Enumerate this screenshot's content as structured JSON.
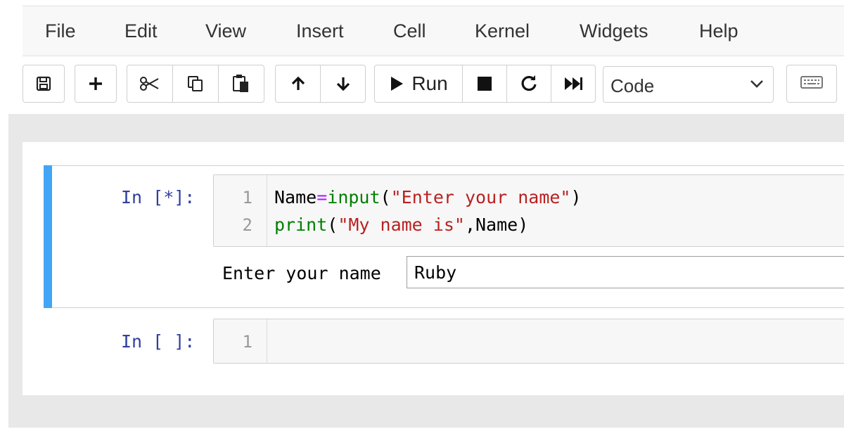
{
  "menubar": {
    "items": [
      "File",
      "Edit",
      "View",
      "Insert",
      "Cell",
      "Kernel",
      "Widgets",
      "Help"
    ]
  },
  "toolbar": {
    "run_label": "Run",
    "cell_type": "Code",
    "icons": [
      "save-icon",
      "plus-icon",
      "cut-icon",
      "copy-icon",
      "paste-icon",
      "arrow-up-icon",
      "arrow-down-icon",
      "play-icon",
      "stop-icon",
      "restart-icon",
      "fast-forward-icon",
      "chevron-down-icon",
      "keyboard-icon"
    ]
  },
  "cells": [
    {
      "prompt": "In [*]:",
      "line_numbers": [
        "1",
        "2"
      ],
      "code": {
        "line1": {
          "var": "Name",
          "op": "=",
          "func": "input",
          "open": "(",
          "str": "\"Enter your name\"",
          "close": ")"
        },
        "line2": {
          "func": "print",
          "open": "(",
          "str": "\"My name is\"",
          "rest": ",Name)"
        }
      },
      "stdin_prompt": "Enter your name",
      "stdin_value": "Ruby"
    },
    {
      "prompt": "In [ ]:",
      "line_numbers": [
        "1"
      ]
    }
  ],
  "colors": {
    "selected_cell_bar": "#42a5f5",
    "prompt": "#303f9f",
    "keyword": "#008000",
    "string": "#ba2121",
    "operator": "#aa22ff"
  }
}
